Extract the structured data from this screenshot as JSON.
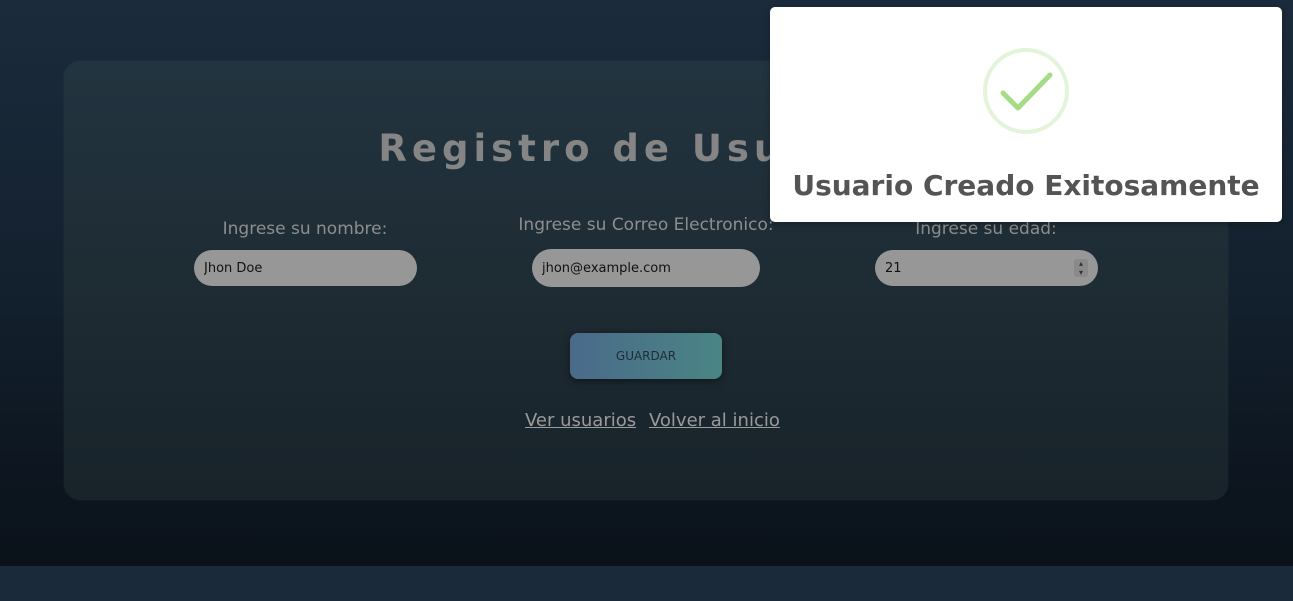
{
  "form": {
    "title": "Registro de Usuarios",
    "name_label": "Ingrese su nombre:",
    "name_value": "Jhon Doe",
    "email_label": "Ingrese su Correo Electronico:",
    "email_value": "jhon@example.com",
    "age_label": "Ingrese su edad:",
    "age_value": "21",
    "save_label": "GUARDAR"
  },
  "links": {
    "view_users": "Ver usuarios",
    "back_home": "Volver al inicio"
  },
  "toast": {
    "icon": "success-check-icon",
    "message": "Usuario Creado Exitosamente",
    "accent": "#a5dc86"
  }
}
